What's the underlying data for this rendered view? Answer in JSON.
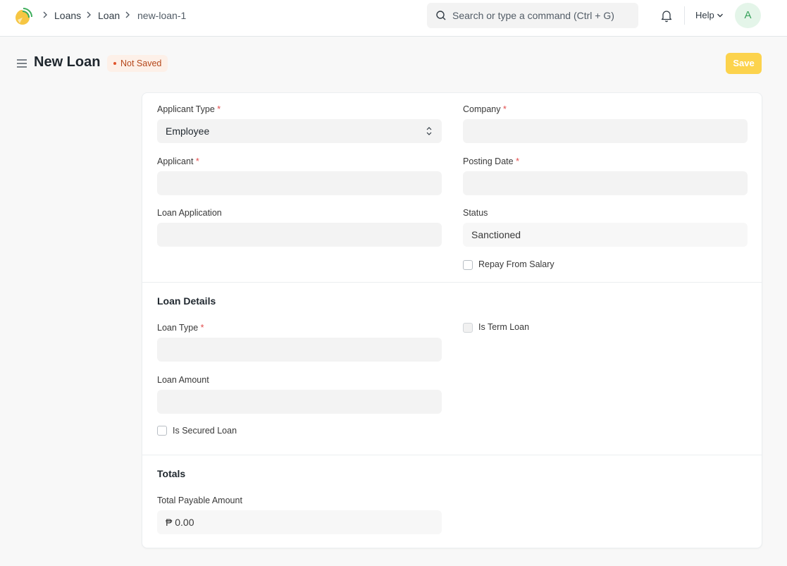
{
  "breadcrumbs": [
    "Loans",
    "Loan",
    "new-loan-1"
  ],
  "search": {
    "placeholder": "Search or type a command (Ctrl + G)"
  },
  "help_label": "Help",
  "avatar_initial": "A",
  "page": {
    "title": "New Loan",
    "status": "Not Saved",
    "save_label": "Save"
  },
  "form": {
    "applicant_type": {
      "label": "Applicant Type",
      "value": "Employee"
    },
    "company": {
      "label": "Company",
      "value": ""
    },
    "applicant": {
      "label": "Applicant",
      "value": ""
    },
    "posting_date": {
      "label": "Posting Date",
      "value": ""
    },
    "loan_application": {
      "label": "Loan Application",
      "value": ""
    },
    "status": {
      "label": "Status",
      "value": "Sanctioned"
    },
    "repay_from_salary": {
      "label": "Repay From Salary",
      "checked": false
    },
    "loan_details": {
      "title": "Loan Details",
      "loan_type": {
        "label": "Loan Type",
        "value": ""
      },
      "is_term_loan": {
        "label": "Is Term Loan",
        "checked": false
      },
      "loan_amount": {
        "label": "Loan Amount",
        "value": ""
      },
      "is_secured_loan": {
        "label": "Is Secured Loan",
        "checked": false
      }
    },
    "totals": {
      "title": "Totals",
      "total_payable_amount": {
        "label": "Total Payable Amount",
        "value": "₱ 0.00"
      }
    }
  },
  "colors": {
    "save_button": "#fcd34d",
    "status_pill_bg": "#fdf0e8",
    "status_pill_text": "#b4471a",
    "required_asterisk": "#e24c4c",
    "avatar_bg": "#e4f5e9",
    "avatar_text": "#36a15a"
  },
  "icons": [
    "app-logo-icon",
    "chevron-right-icon",
    "search-icon",
    "bell-icon",
    "chevron-down-icon",
    "hamburger-icon",
    "select-arrows-icon"
  ]
}
